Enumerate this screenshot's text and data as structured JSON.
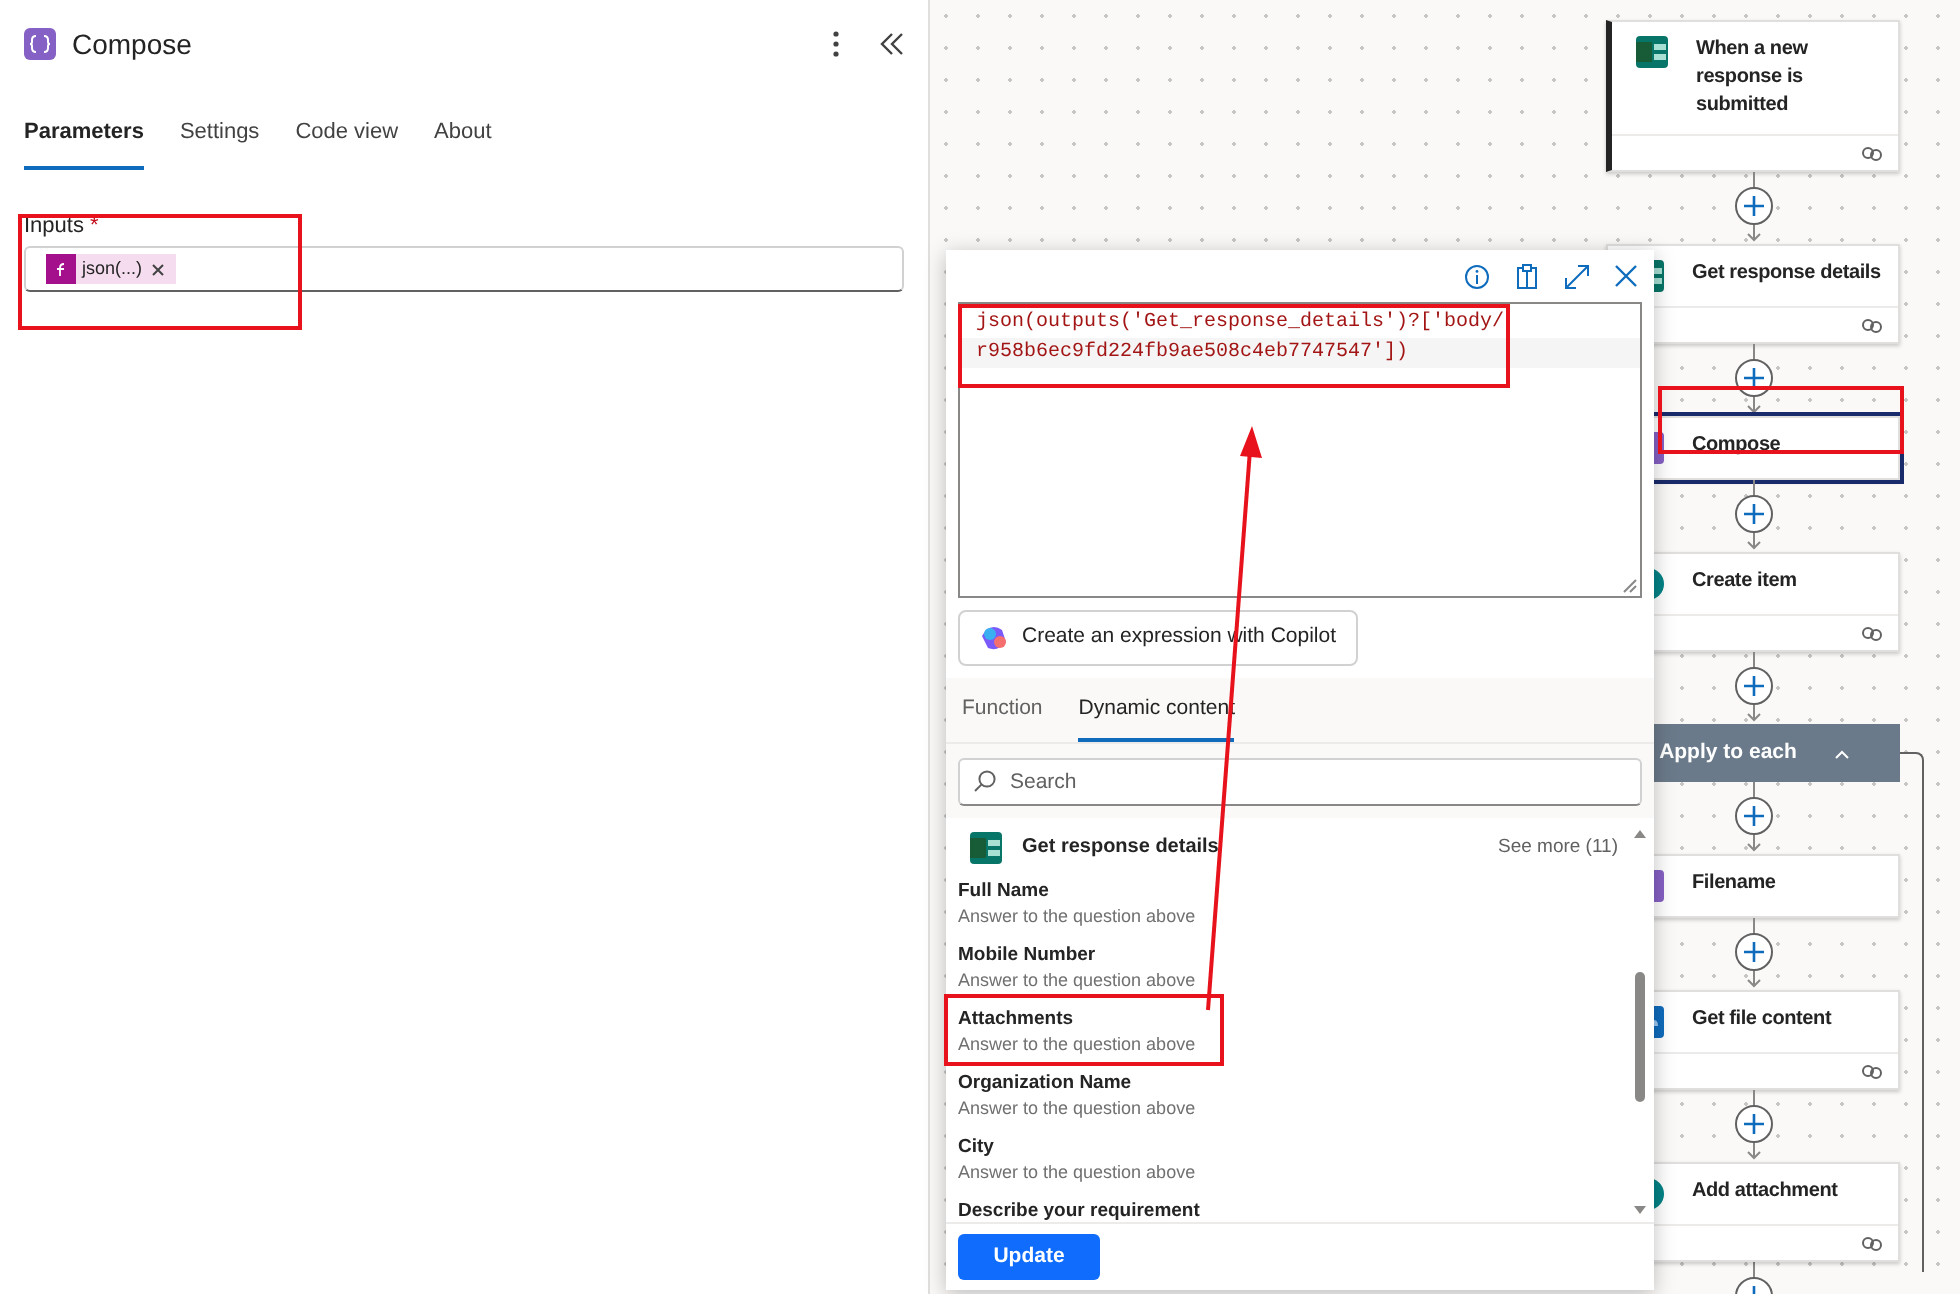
{
  "panel": {
    "title": "Compose",
    "tabs": [
      {
        "label": "Parameters",
        "selected": true
      },
      {
        "label": "Settings",
        "selected": false
      },
      {
        "label": "Code view",
        "selected": false
      },
      {
        "label": "About",
        "selected": false
      }
    ],
    "field": {
      "label": "Inputs",
      "required_mark": "*",
      "token": "json(...)"
    }
  },
  "expression_editor": {
    "code_lines": [
      "json(outputs('Get_response_details')?['body/",
      "r958b6ec9fd224fb9ae508c4eb7747547'])"
    ],
    "copilot_button": "Create an expression with Copilot",
    "tabs": [
      {
        "label": "Function",
        "selected": false
      },
      {
        "label": "Dynamic content",
        "selected": true
      }
    ],
    "search": {
      "placeholder": "Search"
    },
    "group": {
      "title": "Get response details",
      "see_more": "See more (11)"
    },
    "items": [
      {
        "name": "Full Name",
        "description": "Answer to the question above"
      },
      {
        "name": "Mobile Number",
        "description": "Answer to the question above"
      },
      {
        "name": "Attachments",
        "description": "Answer to the question above"
      },
      {
        "name": "Organization Name",
        "description": "Answer to the question above"
      },
      {
        "name": "City",
        "description": "Answer to the question above"
      },
      {
        "name": "Describe your requirement"
      }
    ],
    "update_button": "Update"
  },
  "flow": {
    "steps": [
      {
        "title": "When a new response is submitted",
        "kind": "forms",
        "selected": false,
        "trigger": true,
        "has_link": true
      },
      {
        "title": "Get response details",
        "kind": "forms",
        "selected": false,
        "trigger": false,
        "has_link": true
      },
      {
        "title": "Compose",
        "kind": "compose",
        "selected": true,
        "trigger": false,
        "has_link": false
      },
      {
        "title": "Create item",
        "kind": "sharepoint",
        "selected": false,
        "trigger": false,
        "has_link": true
      },
      {
        "title": "Apply to each",
        "kind": "loop",
        "expanded": true,
        "children": [
          {
            "title": "Filename",
            "kind": "compose",
            "selected": false,
            "trigger": false,
            "has_link": false
          },
          {
            "title": "Get file content",
            "kind": "onedrive",
            "selected": false,
            "trigger": false,
            "has_link": true
          },
          {
            "title": "Add attachment",
            "kind": "sharepoint",
            "selected": false,
            "trigger": false,
            "has_link": true
          }
        ]
      }
    ]
  }
}
